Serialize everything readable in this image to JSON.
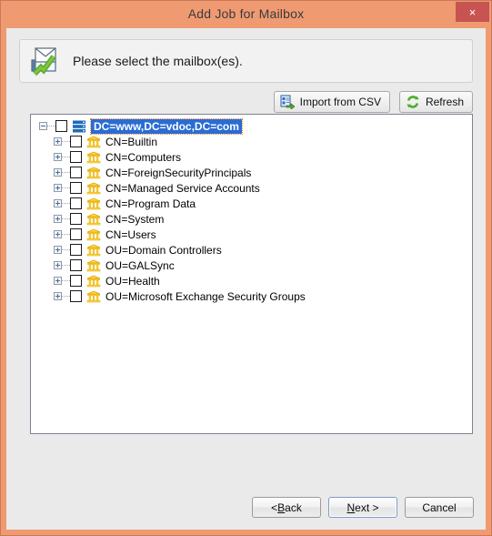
{
  "window": {
    "title": "Add Job for Mailbox",
    "close_label": "×",
    "close_icon": "close-icon",
    "frame_color": "#f09a72",
    "body_color": "#eaeaea"
  },
  "banner": {
    "icon": "mailbox-check-icon",
    "text": "Please select the mailbox(es)."
  },
  "toolbar": {
    "buttons": [
      {
        "label": "Import from CSV",
        "icon": "import-csv-icon"
      },
      {
        "label": "Refresh",
        "icon": "refresh-icon"
      }
    ]
  },
  "tree": {
    "selection_color": "#2a6cd4",
    "focus_outline_color": "#e88a2a",
    "root": {
      "label": "DC=www,DC=vdoc,DC=com",
      "icon": "server-icon",
      "expander": "minus",
      "checked": false,
      "selected": true
    },
    "children": [
      {
        "label": "CN=Builtin",
        "icon": "ou-icon",
        "expander": "plus",
        "checked": false
      },
      {
        "label": "CN=Computers",
        "icon": "ou-icon",
        "expander": "plus",
        "checked": false
      },
      {
        "label": "CN=ForeignSecurityPrincipals",
        "icon": "ou-icon",
        "expander": "plus",
        "checked": false
      },
      {
        "label": "CN=Managed Service Accounts",
        "icon": "ou-icon",
        "expander": "plus",
        "checked": false
      },
      {
        "label": "CN=Program Data",
        "icon": "ou-icon",
        "expander": "plus",
        "checked": false
      },
      {
        "label": "CN=System",
        "icon": "ou-icon",
        "expander": "plus",
        "checked": false
      },
      {
        "label": "CN=Users",
        "icon": "ou-icon",
        "expander": "plus",
        "checked": false
      },
      {
        "label": "OU=Domain Controllers",
        "icon": "ou-icon",
        "expander": "plus",
        "checked": false
      },
      {
        "label": "OU=GALSync",
        "icon": "ou-icon",
        "expander": "plus",
        "checked": false
      },
      {
        "label": "OU=Health",
        "icon": "ou-icon",
        "expander": "plus",
        "checked": false
      },
      {
        "label": "OU=Microsoft Exchange Security Groups",
        "icon": "ou-icon",
        "expander": "plus",
        "checked": false
      }
    ]
  },
  "footer": {
    "back": {
      "pre": "< ",
      "mnemonic": "B",
      "post": "ack"
    },
    "next": {
      "pre": "",
      "mnemonic": "N",
      "post": "ext >"
    },
    "cancel": {
      "label": "Cancel"
    }
  }
}
